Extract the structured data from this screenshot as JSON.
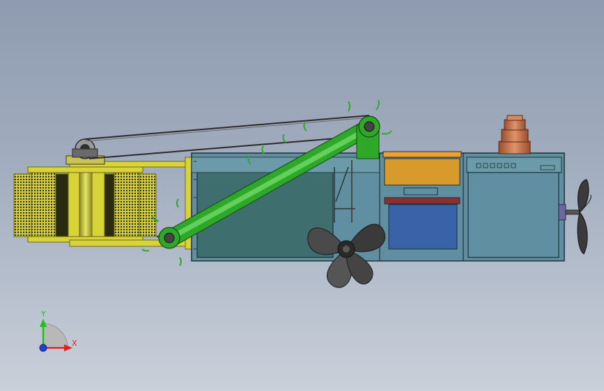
{
  "triad": {
    "y_label": "Y",
    "x_label": "X"
  },
  "colors": {
    "background_top": "#8e9bb0",
    "background_bottom": "#c9d0da",
    "hull_fill": "#5f8fa0",
    "hull_dark": "#3f6e6e",
    "hull_edge": "#1d2f38",
    "frame_green": "#2fa82a",
    "roller_yellow": "#d9d33a",
    "mesh_dark": "#2b2b12",
    "orange_panel": "#f0a030",
    "brown_tank": "#d89a2a",
    "blue_tank": "#3a62a8",
    "red_bar": "#8a3030",
    "chimney": "#c8744c",
    "propeller": "#4a4a4a",
    "axis_x": "#e02020",
    "axis_y": "#20c020",
    "axis_z": "#2040d0"
  }
}
